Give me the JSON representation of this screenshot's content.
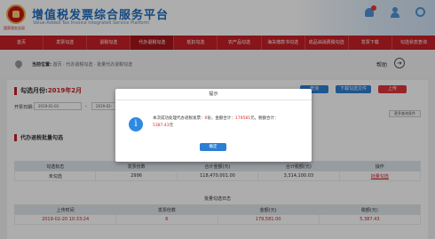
{
  "header": {
    "title": "增值税发票综合服务平台",
    "subtitle": "Value-Added Tax Invoice Integrated Service Platform",
    "brand_sub": "国家税务总局"
  },
  "nav": {
    "items": [
      "首页",
      "发票勾选",
      "退税勾选",
      "代办退税勾选",
      "抵扣勾选",
      "农产品勾选",
      "海关缴款书勾选",
      "成品油消费税勾选",
      "发票下载",
      "勾选状态查询"
    ],
    "active_index": 3
  },
  "breadcrumb": {
    "prefix": "当前位置:",
    "path": "首页 · 代办退税勾选 · 批量代办退税勾选",
    "help_label": "帮助"
  },
  "main": {
    "title_prefix": "勾选月份:",
    "title_month": "2019年2月",
    "btn_query": "查询",
    "btn_download": "下载勾选文件",
    "btn_upload": "上传",
    "filter_label": "开票日期:",
    "date_from": "2019-01-01",
    "date_to": "2019-02-",
    "dash": "-",
    "more_label": "更多查询条件"
  },
  "batch": {
    "title": "代办退税批量勾选",
    "headers": [
      "勾选标志",
      "发票份数",
      "合计金额(元)",
      "合计税额(元)",
      "操作"
    ],
    "row": [
      "未勾选",
      "2996",
      "118,470,001.00",
      "3,314,100.03",
      "批量勾选"
    ]
  },
  "stats": {
    "title": "批量勾选日志",
    "headers": [
      "上传时间",
      "发票份数",
      "金额(元)",
      "税额(元)"
    ],
    "row": [
      "2019-02-20 10:33:24",
      "6",
      "179,581.00",
      "5,387.43"
    ]
  },
  "modal": {
    "title": "提示",
    "msg_a": "本次成功处理代办退税发票：",
    "count": "6",
    "msg_b": "份，金额合计：",
    "amount": "179581",
    "msg_c": "元，税额合计：",
    "tax": "5387.43",
    "msg_d": "元",
    "ok_label": "确定"
  },
  "colors": {
    "brand_red": "#c81f25",
    "accent_blue": "#2d7fd3"
  }
}
